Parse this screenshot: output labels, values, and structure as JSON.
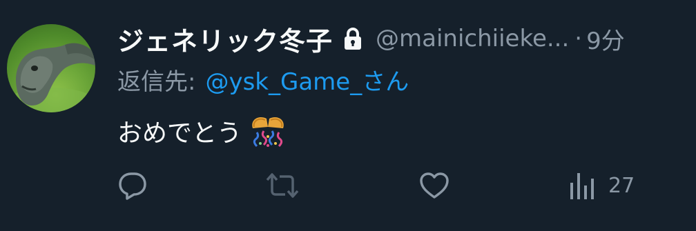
{
  "tweet": {
    "author": {
      "display_name": "ジェネリック冬子",
      "handle": "@mainichiieke...",
      "protected_icon": "lock-icon",
      "avatar": "sea-lion-avatar"
    },
    "separator": "·",
    "time": "9分",
    "reply": {
      "prefix": "返信先:",
      "target": "@ysk_Game_さん"
    },
    "text": "おめでとう",
    "emoji": "confetti-ball",
    "actions": {
      "reply_icon": "reply-icon",
      "retweet_icon": "retweet-icon",
      "like_icon": "heart-icon",
      "views_icon": "views-icon",
      "views_count": "27"
    }
  },
  "colors": {
    "background": "#15202b",
    "primary_text": "#f7f9f9",
    "secondary_text": "#8b98a5",
    "link": "#1d9bf0"
  }
}
